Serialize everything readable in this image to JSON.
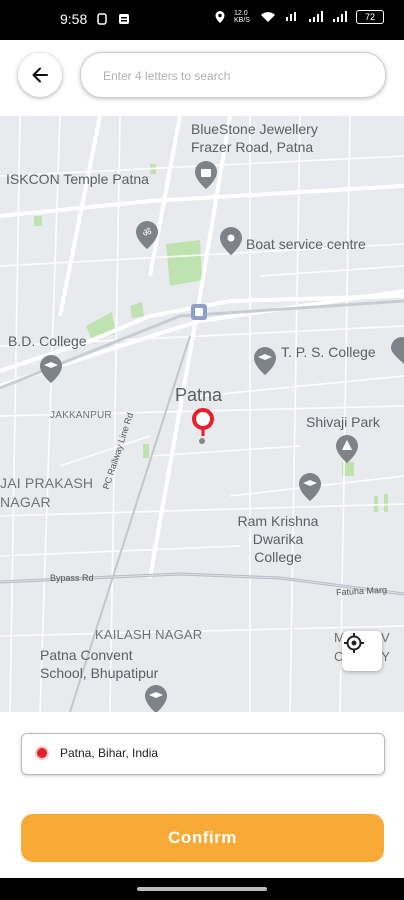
{
  "status_bar": {
    "time": "9:58",
    "battery": "72",
    "data_speed": "12.0 KB/S"
  },
  "search": {
    "placeholder": "Enter 4 letters to search",
    "value": ""
  },
  "map": {
    "pois": [
      {
        "name": "BlueStone Jewellery Frazer Road, Patna",
        "icon": "shopping-bag-icon"
      },
      {
        "name": "ISKCON Temple Patna",
        "icon": "temple-icon"
      },
      {
        "name": "Boat service centre",
        "icon": "pin-icon"
      },
      {
        "name": "B.D. College",
        "icon": "school-icon"
      },
      {
        "name": "T. P. S. College",
        "icon": "school-icon"
      },
      {
        "name": "Shivaji Park",
        "icon": "park-icon"
      },
      {
        "name": "Ram Krishna Dwarika College",
        "icon": "school-icon"
      },
      {
        "name": "Patna Convent School, Bhupatipur",
        "icon": "school-icon"
      }
    ],
    "labels": {
      "city": "Patna",
      "jakkanpur": "JAKKANPUR",
      "jai_prakash": "JAI PRAKASH NAGAR",
      "kailash": "KAILASH NAGAR",
      "madhav": "MADHAV COLONY",
      "bypass": "Bypass Rd",
      "fatuha": "Fatuha Marg",
      "pc_railway": "PC Railway Line Rd"
    },
    "marker_color": "#e8202a"
  },
  "selected_address": "Patna, Bihar, India",
  "confirm_label": "Confirm",
  "accent_color": "#f7ab36"
}
